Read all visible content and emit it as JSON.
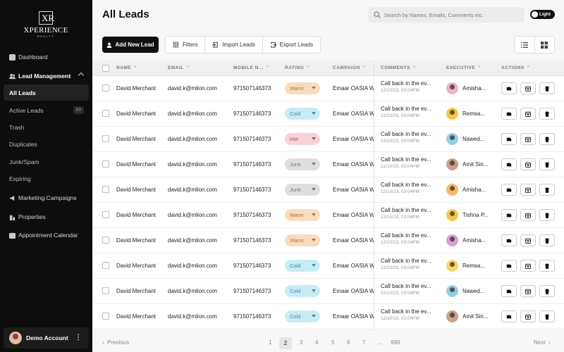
{
  "brand": {
    "mark": "XR",
    "name": "XPERIENCE",
    "sub": "REALTY"
  },
  "sidebar": {
    "dashboard": "Dashboard",
    "lead_management": "Lead Management",
    "sub_items": [
      "All Leads",
      "Active Leads",
      "Trash",
      "Duplicates",
      "Junk/Spam",
      "Expiring"
    ],
    "active_leads_count": "00",
    "marketing": "Marketing Campaigns",
    "properties": "Properties",
    "appointment": "Appointment Calendar",
    "account": "Demo Account"
  },
  "header": {
    "title": "All Leads",
    "search_placeholder": "Search by Names, Emails, Comments etc.",
    "theme_label": "Light"
  },
  "toolbar": {
    "add_label": "Add New Lead",
    "filters_label": "Filters",
    "import_label": "Import Leads",
    "export_label": "Export Leads"
  },
  "table": {
    "headers": [
      "NAME",
      "EMAIL",
      "MOBILE N...",
      "RATING",
      "CAMPAIGN",
      "COMMENTS",
      "EXECUTIVE",
      "ACTIONS"
    ],
    "rows": [
      {
        "name": "David Merchant",
        "email": "david.k@mlion.com",
        "mobile": "971507146373",
        "rating": "Warm",
        "campaign": "Emaar OASIA W",
        "comment": "Call back in the ev...",
        "date": "12/10/23, 03:04PM",
        "exec": "Amisha...",
        "avatar": "#e8b4c4"
      },
      {
        "name": "David Merchant",
        "email": "david.k@mlion.com",
        "mobile": "971507146373",
        "rating": "Cold",
        "campaign": "Emaar OASIA W",
        "comment": "Call back in the ev...",
        "date": "12/10/23, 03:04PM",
        "exec": "Remsa...",
        "avatar": "#f3c94a"
      },
      {
        "name": "David Merchant",
        "email": "david.k@mlion.com",
        "mobile": "971507146373",
        "rating": "Hot",
        "campaign": "Emaar OASIA W",
        "comment": "Call back in the ev...",
        "date": "12/10/23, 03:04PM",
        "exec": "Nawed...",
        "avatar": "#8fd0e8"
      },
      {
        "name": "David Merchant",
        "email": "david.k@mlion.com",
        "mobile": "971507146373",
        "rating": "Junk",
        "campaign": "Emaar OASIA W",
        "comment": "Call back in the ev...",
        "date": "12/10/23, 03:04PM",
        "exec": "Amit Sin...",
        "avatar": "#c9a08a"
      },
      {
        "name": "David Merchant",
        "email": "david.k@mlion.com",
        "mobile": "971507146373",
        "rating": "Junk",
        "campaign": "Emaar OASIA W",
        "comment": "Call back in the ev...",
        "date": "12/10/23, 03:04PM",
        "exec": "Amisha...",
        "avatar": "#f3b96a"
      },
      {
        "name": "David Merchant",
        "email": "david.k@mlion.com",
        "mobile": "971507146373",
        "rating": "Warm",
        "campaign": "Emaar OASIA W",
        "comment": "Call back in the ev...",
        "date": "12/10/23, 03:04PM",
        "exec": "Tishna P...",
        "avatar": "#f3c94a"
      },
      {
        "name": "David Merchant",
        "email": "david.k@mlion.com",
        "mobile": "971507146373",
        "rating": "Warm",
        "campaign": "Emaar OASIA W",
        "comment": "Call back in the ev...",
        "date": "12/10/23, 03:04PM",
        "exec": "Amisha...",
        "avatar": "#d6a0d8"
      },
      {
        "name": "David Merchant",
        "email": "david.k@mlion.com",
        "mobile": "971507146373",
        "rating": "Cold",
        "campaign": "Emaar OASIA W",
        "comment": "Call back in the ev...",
        "date": "12/10/23, 03:04PM",
        "exec": "Remsa...",
        "avatar": "#f3d66a"
      },
      {
        "name": "David Merchant",
        "email": "david.k@mlion.com",
        "mobile": "971507146373",
        "rating": "Cold",
        "campaign": "Emaar OASIA W",
        "comment": "Call back in the ev...",
        "date": "12/10/23, 03:04PM",
        "exec": "Nawed...",
        "avatar": "#8fd0e8"
      },
      {
        "name": "David Merchant",
        "email": "david.k@mlion.com",
        "mobile": "971507146373",
        "rating": "Cold",
        "campaign": "Emaar OASIA W",
        "comment": "Call back in the ev...",
        "date": "12/10/23, 03:04PM",
        "exec": "Amit Sin...",
        "avatar": "#c9a08a"
      }
    ]
  },
  "pagination": {
    "prev": "Previous",
    "next": "Next",
    "pages": [
      "1",
      "2",
      "3",
      "4",
      "5",
      "6",
      "7",
      "...",
      "999"
    ],
    "current": "2"
  },
  "colors": {
    "accent": "#111111",
    "sidebar_bg": "#0d0d0d"
  }
}
